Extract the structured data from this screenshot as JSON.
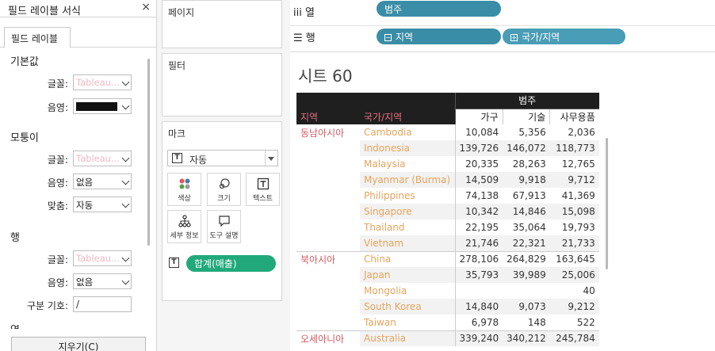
{
  "format_panel": {
    "title": "필드 레이블 서식",
    "close_glyph": "×",
    "tab": "필드 레이블",
    "sections": {
      "default": "기본값",
      "corner": "모퉁이",
      "rows": "행",
      "cols_partial": "열"
    },
    "labels": {
      "font": "글꼴:",
      "shading": "음영:",
      "align": "맞춤:",
      "separator": "구분 기호:"
    },
    "default_font": "Tableau...",
    "corner_font": "Tableau...",
    "corner_shading": "없음",
    "corner_align": "자동",
    "rows_font": "Tableau...",
    "rows_shading": "없음",
    "rows_separator": "/",
    "shading_color": "#111111",
    "clear_button": "지우기(C)"
  },
  "shelves": {
    "pages": "페이지",
    "filters": "필터",
    "marks": "마크",
    "columns_label": "열",
    "rows_label": "행",
    "columns_pills": [
      "범주"
    ],
    "rows_pills": [
      "지역",
      "국가/지역"
    ]
  },
  "marks": {
    "type": "자동",
    "buttons": [
      "색상",
      "크기",
      "텍스트",
      "세부 정보",
      "도구 설명"
    ],
    "text_pill": "합계(매출)"
  },
  "sheet": {
    "title": "시트 60",
    "header_top": "범주",
    "col_region": "지역",
    "col_country": "국가/지역",
    "measures": [
      "가구",
      "기술",
      "사무용품"
    ],
    "rows": [
      {
        "region": "동남아시아",
        "country": "Cambodia",
        "v": [
          "10,084",
          "5,356",
          "2,036"
        ]
      },
      {
        "region": "",
        "country": "Indonesia",
        "v": [
          "139,726",
          "146,072",
          "118,773"
        ]
      },
      {
        "region": "",
        "country": "Malaysia",
        "v": [
          "20,335",
          "28,263",
          "12,765"
        ]
      },
      {
        "region": "",
        "country": "Myanmar (Burma)",
        "v": [
          "14,509",
          "9,918",
          "9,712"
        ]
      },
      {
        "region": "",
        "country": "Philippines",
        "v": [
          "74,138",
          "67,913",
          "41,369"
        ]
      },
      {
        "region": "",
        "country": "Singapore",
        "v": [
          "10,342",
          "14,846",
          "15,098"
        ]
      },
      {
        "region": "",
        "country": "Thailand",
        "v": [
          "22,195",
          "35,064",
          "19,793"
        ]
      },
      {
        "region": "",
        "country": "Vietnam",
        "v": [
          "21,746",
          "22,321",
          "21,733"
        ]
      },
      {
        "region": "북아시아",
        "country": "China",
        "v": [
          "278,106",
          "264,829",
          "163,645"
        ]
      },
      {
        "region": "",
        "country": "Japan",
        "v": [
          "35,793",
          "39,989",
          "25,006"
        ]
      },
      {
        "region": "",
        "country": "Mongolia",
        "v": [
          "",
          "",
          "40"
        ]
      },
      {
        "region": "",
        "country": "South Korea",
        "v": [
          "14,840",
          "9,073",
          "9,212"
        ]
      },
      {
        "region": "",
        "country": "Taiwan",
        "v": [
          "6,978",
          "148",
          "522"
        ]
      },
      {
        "region": "오세아니아",
        "country": "Australia",
        "v": [
          "339,240",
          "340,212",
          "245,784"
        ]
      }
    ]
  },
  "colors": {
    "pill_blue": "#3a8da6",
    "pill_green": "#21a97b",
    "header_dark": "#1f1f1f",
    "region_text": "#d45b62",
    "country_text": "#e6a45d"
  }
}
